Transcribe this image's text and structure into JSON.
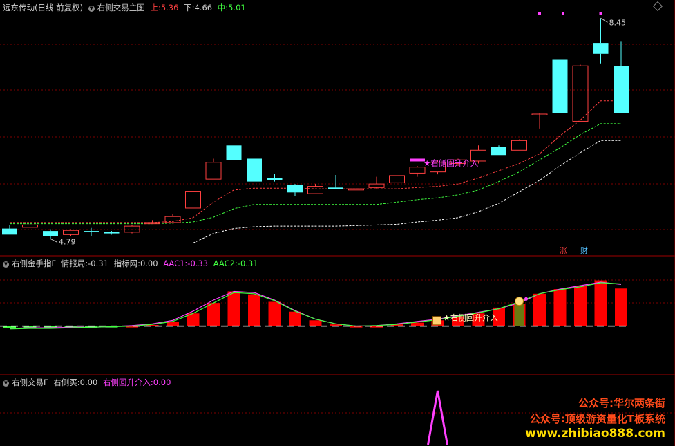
{
  "panel1": {
    "stock": "远东传动(日线 前复权)",
    "indicator": "右侧交易主图",
    "upper_label": "上:",
    "upper_value": "5.36",
    "lower_label": "下:",
    "lower_value": "4.66",
    "mid_label": "中:",
    "mid_value": "5.01",
    "high_mark": "8.45",
    "low_mark": "4.79",
    "signal_text": "★右侧回升介入",
    "badge_zhang": "涨",
    "badge_cai": "财"
  },
  "panel2": {
    "title": "右侧金手指F",
    "info_label": "情报局:",
    "info_value": "-0.31",
    "net_label": "指标网:",
    "net_value": "0.00",
    "aac1_label": "AAC1:",
    "aac1_value": "-0.33",
    "aac2_label": "AAC2:",
    "aac2_value": "-0.31",
    "signal_text": "★右侧回升介入"
  },
  "panel3": {
    "title": "右侧交易F",
    "buy_label": "右侧买:",
    "buy_value": "0.00",
    "entry_label": "右侧回升介入:",
    "entry_value": "0.00"
  },
  "watermark": {
    "line1": "公众号:华尔两条街",
    "line2": "公众号:顶级游资量化T板系统",
    "line3": "www.zhibiao888.com"
  },
  "colors": {
    "up": "#ff4040",
    "down": "#54ffff",
    "upper_band": "#ff4040",
    "mid_band": "#40ff40",
    "lower_band": "#ffffff",
    "magenta": "#ff40ff",
    "grid": "#800000"
  },
  "chart_data": {
    "type": "candlestick",
    "price_ylim": [
      4.6,
      8.5
    ],
    "candles": [
      {
        "o": 4.96,
        "h": 5.02,
        "l": 4.86,
        "c": 4.86
      },
      {
        "o": 4.98,
        "h": 5.05,
        "l": 4.94,
        "c": 5.02
      },
      {
        "o": 4.92,
        "h": 4.95,
        "l": 4.79,
        "c": 4.84
      },
      {
        "o": 4.86,
        "h": 4.95,
        "l": 4.84,
        "c": 4.93
      },
      {
        "o": 4.92,
        "h": 4.97,
        "l": 4.84,
        "c": 4.9
      },
      {
        "o": 4.9,
        "h": 4.92,
        "l": 4.86,
        "c": 4.88
      },
      {
        "o": 4.9,
        "h": 5.02,
        "l": 4.88,
        "c": 5.0
      },
      {
        "o": 5.04,
        "h": 5.1,
        "l": 5.04,
        "c": 5.06
      },
      {
        "o": 5.06,
        "h": 5.2,
        "l": 5.06,
        "c": 5.16
      },
      {
        "o": 5.3,
        "h": 5.86,
        "l": 5.3,
        "c": 5.58
      },
      {
        "o": 5.78,
        "h": 6.12,
        "l": 5.78,
        "c": 6.06
      },
      {
        "o": 6.34,
        "h": 6.38,
        "l": 5.98,
        "c": 6.1
      },
      {
        "o": 6.12,
        "h": 6.12,
        "l": 5.74,
        "c": 5.74
      },
      {
        "o": 5.8,
        "h": 5.87,
        "l": 5.74,
        "c": 5.77
      },
      {
        "o": 5.69,
        "h": 5.7,
        "l": 5.5,
        "c": 5.56
      },
      {
        "o": 5.54,
        "h": 5.7,
        "l": 5.54,
        "c": 5.66
      },
      {
        "o": 5.64,
        "h": 5.85,
        "l": 5.62,
        "c": 5.62
      },
      {
        "o": 5.6,
        "h": 5.64,
        "l": 5.58,
        "c": 5.62
      },
      {
        "o": 5.64,
        "h": 5.82,
        "l": 5.62,
        "c": 5.7
      },
      {
        "o": 5.72,
        "h": 5.9,
        "l": 5.72,
        "c": 5.84
      },
      {
        "o": 5.88,
        "h": 6.0,
        "l": 5.82,
        "c": 5.98
      },
      {
        "o": 5.9,
        "h": 6.1,
        "l": 5.86,
        "c": 6.06
      },
      {
        "o": 6.04,
        "h": 6.12,
        "l": 6.0,
        "c": 6.1
      },
      {
        "o": 6.08,
        "h": 6.34,
        "l": 6.04,
        "c": 6.26
      },
      {
        "o": 6.32,
        "h": 6.34,
        "l": 6.18,
        "c": 6.18
      },
      {
        "o": 6.26,
        "h": 6.44,
        "l": 6.26,
        "c": 6.42
      },
      {
        "o": 6.86,
        "h": 6.88,
        "l": 6.62,
        "c": 6.86
      },
      {
        "o": 7.76,
        "h": 7.76,
        "l": 6.88,
        "c": 6.88
      },
      {
        "o": 6.74,
        "h": 7.68,
        "l": 6.74,
        "c": 7.66
      },
      {
        "o": 8.04,
        "h": 8.45,
        "l": 7.7,
        "c": 7.86
      },
      {
        "o": 7.66,
        "h": 8.06,
        "l": 6.88,
        "c": 6.88
      }
    ],
    "upper_band": [
      5.06,
      5.06,
      5.06,
      5.06,
      5.06,
      5.06,
      5.06,
      5.06,
      5.08,
      5.14,
      5.4,
      5.6,
      5.63,
      5.63,
      5.63,
      5.62,
      5.62,
      5.62,
      5.62,
      5.62,
      5.64,
      5.66,
      5.7,
      5.8,
      5.92,
      6.04,
      6.2,
      6.5,
      6.76,
      7.08,
      7.08
    ],
    "mid_band": [
      5.04,
      5.04,
      5.04,
      5.04,
      5.04,
      5.04,
      5.04,
      5.04,
      5.05,
      5.07,
      5.15,
      5.29,
      5.36,
      5.36,
      5.36,
      5.36,
      5.36,
      5.36,
      5.36,
      5.4,
      5.44,
      5.47,
      5.52,
      5.6,
      5.74,
      5.9,
      6.1,
      6.3,
      6.52,
      6.7,
      6.7
    ],
    "lower_band": [
      null,
      null,
      null,
      null,
      null,
      null,
      null,
      null,
      null,
      4.72,
      4.88,
      4.96,
      4.99,
      5.0,
      5.0,
      5.0,
      5.0,
      5.01,
      5.02,
      5.03,
      5.07,
      5.1,
      5.14,
      5.24,
      5.38,
      5.57,
      5.76,
      6.0,
      6.22,
      6.42,
      6.42
    ],
    "signal_index": 21,
    "osc_ylim": [
      -0.1,
      1.0
    ],
    "osc_bars": [
      -0.04,
      -0.03,
      -0.03,
      -0.03,
      -0.03,
      -0.02,
      0.0,
      0.02,
      0.08,
      0.22,
      0.4,
      0.6,
      0.55,
      0.42,
      0.25,
      0.1,
      0.03,
      0.0,
      0.0,
      0.03,
      0.06,
      0.1,
      0.17,
      0.22,
      0.32,
      0.38,
      0.56,
      0.64,
      0.69,
      0.79,
      0.65
    ],
    "osc_aac1": [
      -0.04,
      -0.03,
      -0.03,
      -0.02,
      -0.02,
      -0.01,
      0.01,
      0.04,
      0.1,
      0.26,
      0.45,
      0.6,
      0.58,
      0.45,
      0.27,
      0.12,
      0.04,
      0.0,
      0.01,
      0.04,
      0.08,
      0.12,
      0.18,
      0.24,
      0.3,
      0.4,
      0.56,
      0.64,
      0.7,
      0.76,
      0.72
    ],
    "osc_aac2": [
      -0.05,
      -0.04,
      -0.04,
      -0.03,
      -0.02,
      -0.01,
      0.0,
      0.03,
      0.08,
      0.22,
      0.4,
      0.58,
      0.56,
      0.44,
      0.26,
      0.12,
      0.04,
      0.0,
      0.01,
      0.03,
      0.07,
      0.11,
      0.17,
      0.23,
      0.3,
      0.42,
      0.56,
      0.63,
      0.68,
      0.75,
      0.73
    ],
    "spike_index": 21,
    "spike_value": 1.0
  }
}
